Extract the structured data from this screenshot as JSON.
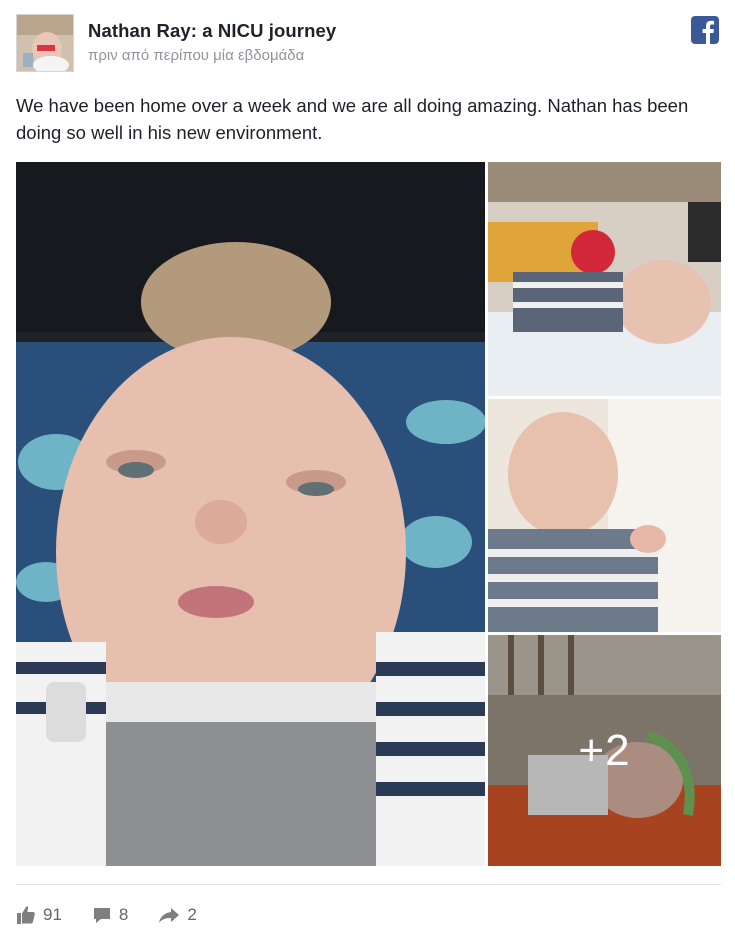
{
  "post": {
    "page_name": "Nathan Ray: a NICU journey",
    "timestamp": "πριν από περίπου μία εβδομάδα",
    "text": "We have been home over a week and we are all doing amazing. Nathan has been doing so well in his new environment.",
    "network_icon": "facebook-icon",
    "brand_color": "#3b5998"
  },
  "photos": {
    "items": [
      {
        "name": "baby-closeup-photo"
      },
      {
        "name": "baby-lying-with-toy-photo"
      },
      {
        "name": "baby-on-blanket-photo"
      },
      {
        "name": "baby-with-equipment-photo"
      }
    ],
    "more_label": "+2"
  },
  "stats": {
    "likes": "91",
    "comments": "8",
    "shares": "2",
    "icons": [
      "like-icon",
      "comment-icon",
      "share-icon"
    ]
  }
}
